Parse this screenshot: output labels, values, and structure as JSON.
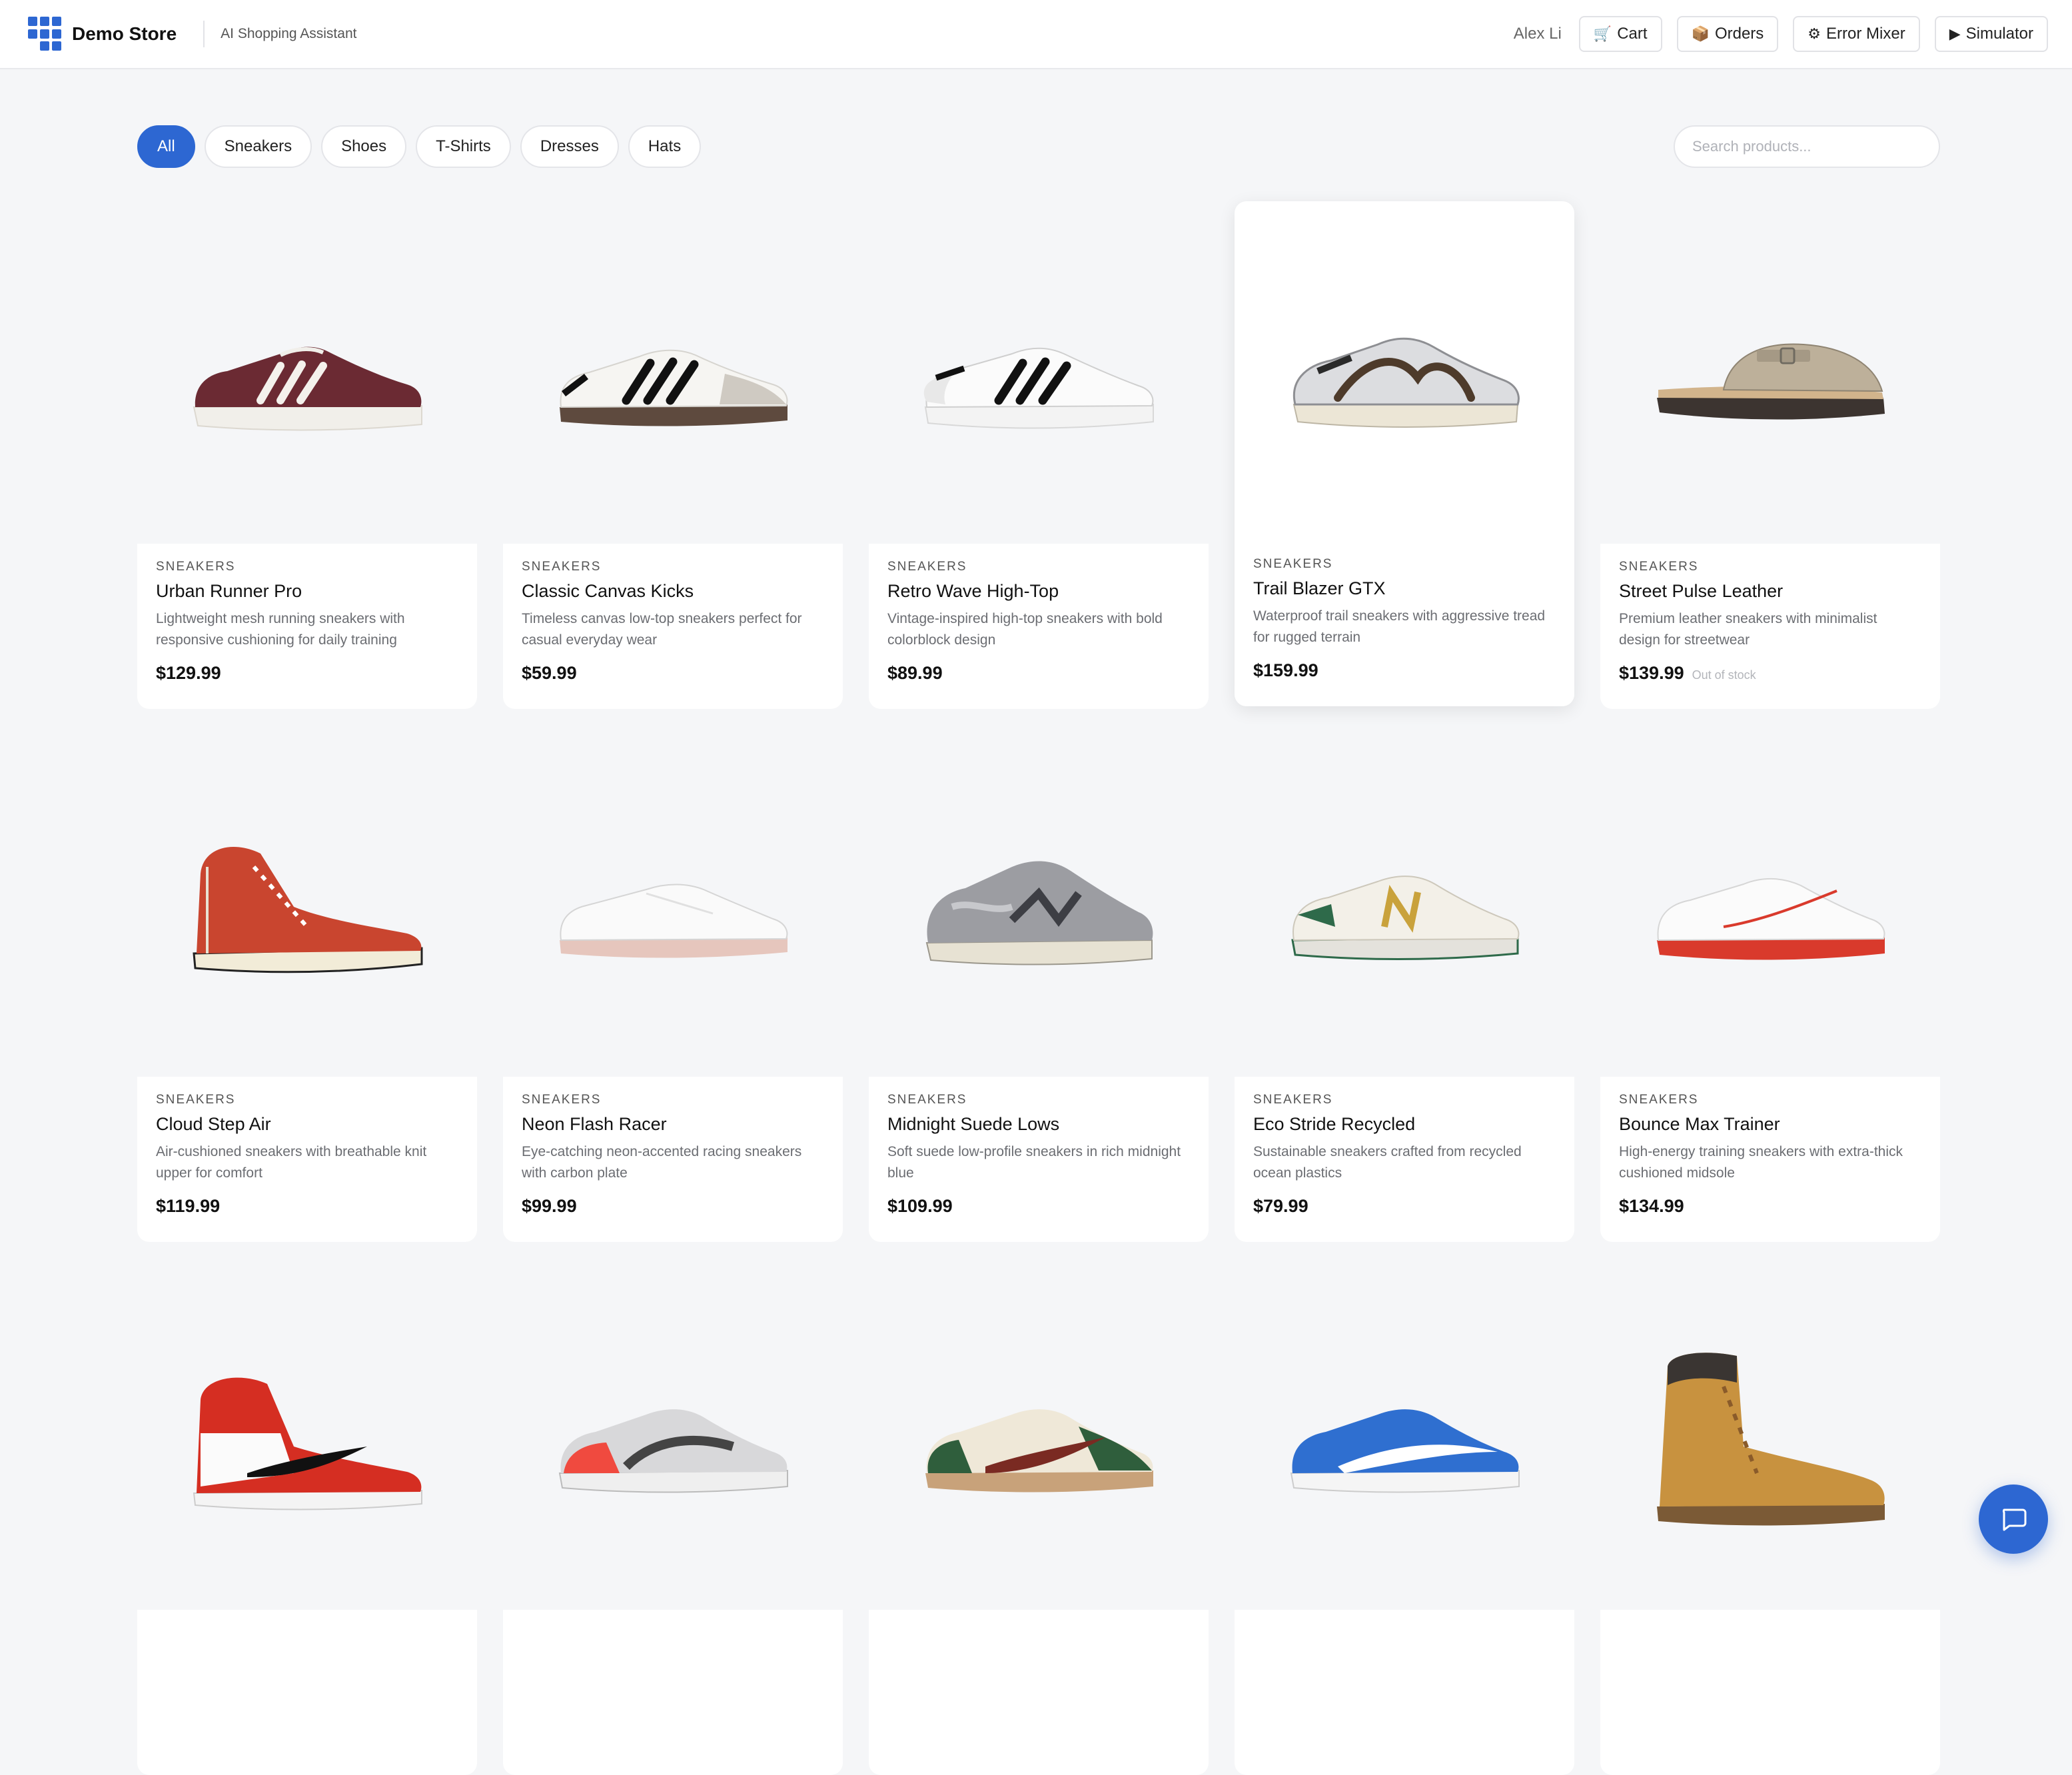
{
  "header": {
    "brand": "Demo Store",
    "tagline": "AI Shopping Assistant",
    "user": "Alex Li",
    "buttons": [
      {
        "label": "Cart",
        "icon": "cart-icon",
        "glyph": "🛒"
      },
      {
        "label": "Orders",
        "icon": "package-icon",
        "glyph": "📦"
      },
      {
        "label": "Error Mixer",
        "icon": "gear-icon",
        "glyph": "⚙"
      },
      {
        "label": "Simulator",
        "icon": "play-icon",
        "glyph": "▶"
      }
    ]
  },
  "filters": {
    "chips": [
      "All",
      "Sneakers",
      "Shoes",
      "T-Shirts",
      "Dresses",
      "Hats"
    ],
    "active": "All",
    "search_placeholder": "Search products..."
  },
  "colors": {
    "accent": "#2d67d2",
    "background": "#f5f6f8"
  },
  "products": [
    {
      "category": "SNEAKERS",
      "name": "Urban Runner Pro",
      "description": "Lightweight mesh running sneakers with responsive cushioning for daily training",
      "price": "$129.99",
      "stock": "",
      "image": "sneaker-maroon-platform"
    },
    {
      "category": "SNEAKERS",
      "name": "Classic Canvas Kicks",
      "description": "Timeless canvas low-top sneakers perfect for casual everyday wear",
      "price": "$59.99",
      "stock": "",
      "image": "sneaker-white-black-stripes-gum"
    },
    {
      "category": "SNEAKERS",
      "name": "Retro Wave High-Top",
      "description": "Vintage-inspired high-top sneakers with bold colorblock design",
      "price": "$89.99",
      "stock": "",
      "image": "sneaker-white-black-stripes-shell"
    },
    {
      "category": "SNEAKERS",
      "name": "Trail Blazer GTX",
      "description": "Waterproof trail sneakers with aggressive tread for rugged terrain",
      "price": "$159.99",
      "stock": "",
      "image": "sneaker-silver-brown-runner"
    },
    {
      "category": "SNEAKERS",
      "name": "Street Pulse Leather",
      "description": "Premium leather sneakers with minimalist design for streetwear",
      "price": "$139.99",
      "stock": "Out of stock",
      "image": "clog-taupe-suede"
    },
    {
      "category": "SNEAKERS",
      "name": "Cloud Step Air",
      "description": "Air-cushioned sneakers with breathable knit upper for comfort",
      "price": "$119.99",
      "stock": "",
      "image": "hightop-red-canvas"
    },
    {
      "category": "SNEAKERS",
      "name": "Neon Flash Racer",
      "description": "Eye-catching neon-accented racing sneakers with carbon plate",
      "price": "$99.99",
      "stock": "",
      "image": "sneaker-white-minimal-pink-sole"
    },
    {
      "category": "SNEAKERS",
      "name": "Midnight Suede Lows",
      "description": "Soft suede low-profile sneakers in rich midnight blue",
      "price": "$109.99",
      "stock": "",
      "image": "sneaker-grey-suede-runner"
    },
    {
      "category": "SNEAKERS",
      "name": "Eco Stride Recycled",
      "description": "Sustainable sneakers crafted from recycled ocean plastics",
      "price": "$79.99",
      "stock": "",
      "image": "sneaker-cream-green-gold"
    },
    {
      "category": "SNEAKERS",
      "name": "Bounce Max Trainer",
      "description": "High-energy training sneakers with extra-thick cushioned midsole",
      "price": "$134.99",
      "stock": "",
      "image": "sneaker-white-red-sole"
    },
    {
      "category": "",
      "name": "",
      "description": "",
      "price": "",
      "stock": "",
      "image": "hightop-red-white-black"
    },
    {
      "category": "",
      "name": "",
      "description": "",
      "price": "",
      "stock": "",
      "image": "sneaker-grey-infrared"
    },
    {
      "category": "",
      "name": "",
      "description": "",
      "price": "",
      "stock": "",
      "image": "sneaker-green-red-cream"
    },
    {
      "category": "",
      "name": "",
      "description": "",
      "price": "",
      "stock": "",
      "image": "sneaker-blue-suede-white"
    },
    {
      "category": "",
      "name": "",
      "description": "",
      "price": "",
      "stock": "",
      "image": "boot-wheat-leather"
    }
  ],
  "chat": {
    "icon": "chat-icon"
  }
}
